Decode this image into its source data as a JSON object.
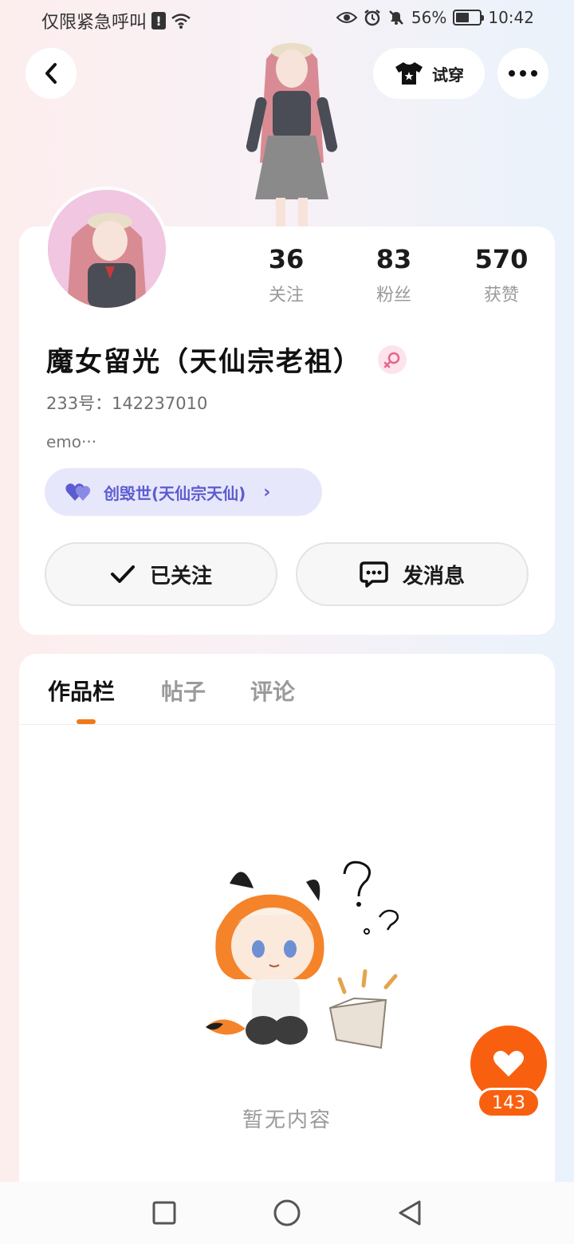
{
  "status_bar": {
    "carrier_text": "仅限紧急呼叫",
    "alert_glyph": "!",
    "battery": "56%",
    "time": "10:42"
  },
  "header": {
    "try_on_label": "试穿"
  },
  "profile": {
    "stats": [
      {
        "value": "36",
        "label": "关注"
      },
      {
        "value": "83",
        "label": "粉丝"
      },
      {
        "value": "570",
        "label": "获赞"
      }
    ],
    "name": "魔女留光（天仙宗老祖）",
    "uid": "233号：142237010",
    "bio": "emo···",
    "guild": "创毁世(天仙宗天仙)",
    "follow_label": "已关注",
    "message_label": "发消息"
  },
  "tabs": [
    {
      "label": "作品栏"
    },
    {
      "label": "帖子"
    },
    {
      "label": "评论"
    }
  ],
  "empty_state": {
    "text": "暂无内容"
  },
  "like": {
    "count": "143"
  },
  "colors": {
    "accent_orange": "#f8600f",
    "tab_indicator": "#f07a1a",
    "guild_bg": "#e7e7fb",
    "guild_text": "#5c5cd1",
    "gender_badge": "#fde3ec"
  }
}
